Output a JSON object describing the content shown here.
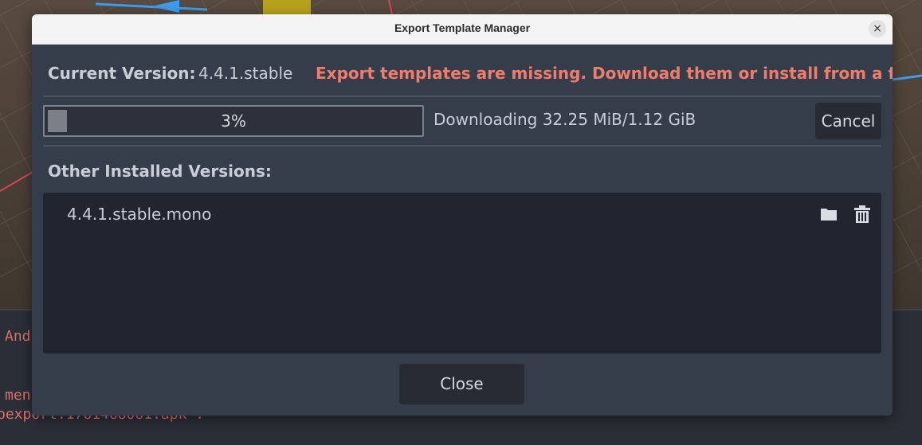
{
  "dialog": {
    "title": "Export Template Manager",
    "close_glyph": "×"
  },
  "current": {
    "label": "Current Version:",
    "value": "4.4.1.stable",
    "warning": "Export templates are missing. Download them or install from a file."
  },
  "download": {
    "progress_fraction": 0.03,
    "progress_text": "3%",
    "status": "Downloading 32.25 MiB/1.12 GiB",
    "cancel_label": "Cancel"
  },
  "installed": {
    "label": "Other Installed Versions:",
    "versions": [
      {
        "name": "4.4.1.stable.mono",
        "open_icon": "folder-icon",
        "remove_icon": "trash-icon"
      }
    ]
  },
  "footer": {
    "close_label": "Close"
  },
  "background": {
    "console_lines": [
      "And",
      "men",
      "bexport:1761468061.apk'."
    ]
  },
  "colors": {
    "warning": "#f07c6b",
    "dialog_bg": "#363d4a",
    "list_bg": "#212530",
    "button_bg": "#262b34"
  }
}
